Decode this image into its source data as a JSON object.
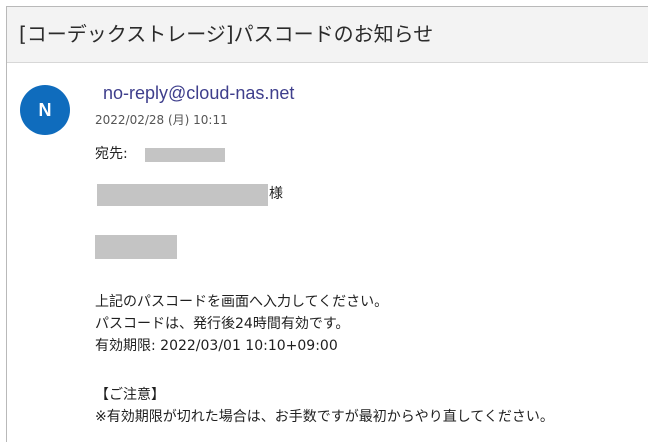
{
  "email": {
    "subject": "[コーデックストレージ]パスコードのお知らせ",
    "sender_initial": "N",
    "sender": "no-reply@cloud-nas.net",
    "date": "2022/02/28 (月) 10:11",
    "to_label": "宛先:",
    "honorific": "様",
    "body_lines": [
      "上記のパスコードを画面へ入力してください。",
      "パスコードは、発行後24時間有効です。",
      "有効期限: 2022/03/01 10:10+09:00"
    ],
    "notice_heading": "【ご注意】",
    "notice_text": "※有効期限が切れた場合は、お手数ですが最初からやり直してください。"
  },
  "colors": {
    "avatar": "#0f6cbd",
    "sender_link": "#3e3e8c",
    "redaction": "#c4c4c4"
  }
}
